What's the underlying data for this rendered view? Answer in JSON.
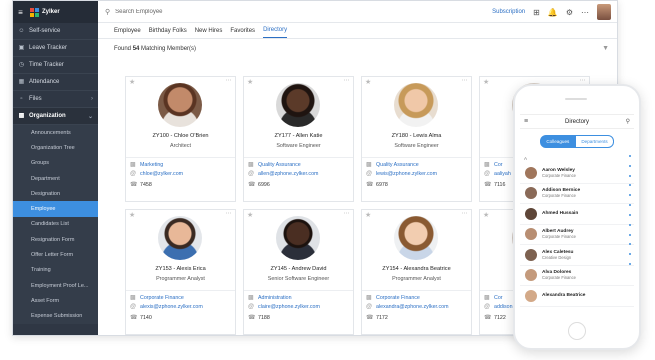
{
  "app": {
    "name": "Zylker"
  },
  "sidebar": {
    "items": [
      {
        "label": "Self-service",
        "icon": "user-icon"
      },
      {
        "label": "Leave Tracker",
        "icon": "briefcase-icon"
      },
      {
        "label": "Time Tracker",
        "icon": "clock-icon"
      },
      {
        "label": "Attendance",
        "icon": "calendar-icon"
      },
      {
        "label": "Files",
        "icon": "folder-icon"
      },
      {
        "label": "Organization",
        "icon": "org-icon"
      }
    ],
    "sub_items": [
      "Announcements",
      "Organization Tree",
      "Groups",
      "Department",
      "Designation",
      "Employee",
      "Candidates List",
      "Resignation Form",
      "Offer Letter Form",
      "Training",
      "Employment Proof Le...",
      "Asset Form",
      "Expense Submission"
    ],
    "active_sub": "Employee"
  },
  "search": {
    "placeholder": "Search Employee"
  },
  "topbar": {
    "subscription_label": "Subscription"
  },
  "tabs": [
    "Employee",
    "Birthday Folks",
    "New Hires",
    "Favorites",
    "Directory"
  ],
  "active_tab": "Directory",
  "results": {
    "prefix": "Found ",
    "count": "54",
    "suffix": " Matching Member(s)"
  },
  "cards": [
    {
      "name": "ZY100 - Chloe O'Brien",
      "role": "Architect",
      "dept": "Marketing",
      "email": "chloe@zylker.com",
      "ext": "7458"
    },
    {
      "name": "ZY177 - Allen Katie",
      "role": "Software Engineer",
      "dept": "Quality Assurance",
      "email": "allen@zphone.zylker.com",
      "ext": "6996"
    },
    {
      "name": "ZY180 - Lewis Alma",
      "role": "Software Engineer",
      "dept": "Quality Assurance",
      "email": "lewis@zphone.zylker.com",
      "ext": "6978"
    },
    {
      "name": "",
      "role": "",
      "dept": "Cor",
      "email": "aaliyah",
      "ext": "7116"
    },
    {
      "name": "ZY153 - Alexis Erica",
      "role": "Programmer Analyst",
      "dept": "Corporate Finance",
      "email": "alexis@zphone.zylker.com",
      "ext": "7140"
    },
    {
      "name": "ZY145 - Andrew David",
      "role": "Senior Software Engineer",
      "dept": "Administration",
      "email": "claire@zphone.zylker.com",
      "ext": "7188"
    },
    {
      "name": "ZY154 - Alexandra Beatrice",
      "role": "Programmer Analyst",
      "dept": "Corporate Finance",
      "email": "alexandra@zphone.zylker.com",
      "ext": "7172"
    },
    {
      "name": "",
      "role": "",
      "dept": "Cor",
      "email": "addison",
      "ext": "7122"
    }
  ],
  "phone": {
    "title": "Directory",
    "segments": [
      "Colleagues",
      "Departments"
    ],
    "letter": "A",
    "people": [
      {
        "name": "Aaron Welsley",
        "role": "Corporate Finance"
      },
      {
        "name": "Addison Bernice",
        "role": "Corporate Finance"
      },
      {
        "name": "Ahmed Hussain",
        "role": ""
      },
      {
        "name": "Albert Audrey",
        "role": "Corporate Finance"
      },
      {
        "name": "Alex Caletesu",
        "role": "Creative Design"
      },
      {
        "name": "Alva Dolores",
        "role": "Corporate Finance"
      },
      {
        "name": "Alexandra Beatrice",
        "role": ""
      }
    ]
  },
  "colors": {
    "accent": "#3d8fe0",
    "sidebar": "#2f3744",
    "link": "#2b6fc4"
  }
}
